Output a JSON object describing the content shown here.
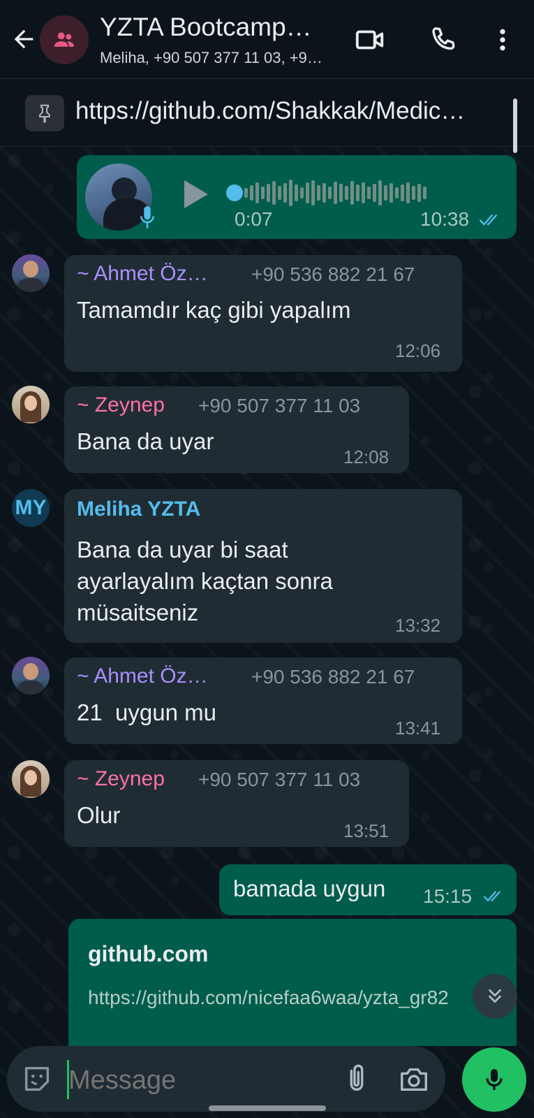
{
  "header": {
    "title": "YZTA Bootcamp…",
    "subtitle": "Meliha, +90 507 377 11 03, +9…"
  },
  "pinned": {
    "text": "https://github.com/Shakkak/Medic…"
  },
  "voice_message": {
    "duration": "0:07",
    "time": "10:38"
  },
  "messages": [
    {
      "name": "~ Ahmet Öz…",
      "phone": "+90 536 882 21 67",
      "text": "Tamamdır kaç gibi yapalım",
      "time": "12:06",
      "name_color": "#a791ff"
    },
    {
      "name": "~ Zeynep",
      "phone": "+90 507 377 11 03",
      "text": "Bana da uyar",
      "time": "12:08",
      "name_color": "#ff72a1"
    },
    {
      "name": "Meliha YZTA",
      "avatar_initials": "MY",
      "text": "Bana da uyar bi saat ayarlayalım kaçtan sonra müsaitseniz",
      "time": "13:32",
      "name_color": "#53bdeb"
    },
    {
      "name": "~ Ahmet Öz…",
      "phone": "+90 536 882 21 67",
      "text": "21  uygun mu",
      "time": "13:41",
      "name_color": "#a791ff"
    },
    {
      "name": "~ Zeynep",
      "phone": "+90 507 377 11 03",
      "text": "Olur",
      "time": "13:51",
      "name_color": "#ff72a1"
    }
  ],
  "outgoing": {
    "text": "bamada uygun",
    "time": "15:15"
  },
  "link_preview": {
    "domain": "github.com",
    "url": "https://github.com/nicefaa6waa/yzta_gr82"
  },
  "input": {
    "placeholder": "Message"
  },
  "colors": {
    "accent": "#21c063",
    "outgoing_bubble": "#005c4b",
    "incoming_bubble": "#202c33",
    "read_tick": "#53bdeb"
  }
}
